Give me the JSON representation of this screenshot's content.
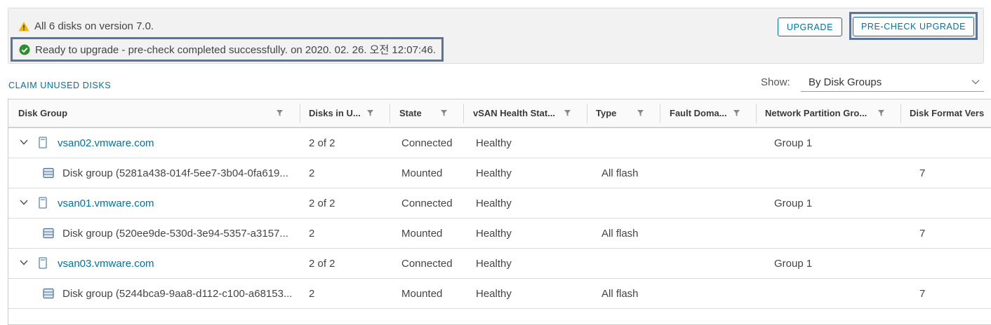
{
  "status": {
    "warning_text": "All 6 disks on version 7.0.",
    "success_text": "Ready to upgrade - pre-check completed successfully. on 2020. 02. 26. 오전 12:07:46.",
    "warning_icon": "warning-triangle-icon",
    "success_icon": "check-circle-icon",
    "warning_color": "#f2b705",
    "success_color": "#2e8d2e"
  },
  "actions": {
    "upgrade_label": "UPGRADE",
    "precheck_label": "PRE-CHECK UPGRADE",
    "claim_label": "CLAIM UNUSED DISKS"
  },
  "view": {
    "show_label": "Show:",
    "show_value": "By Disk Groups"
  },
  "table": {
    "columns": [
      "Disk Group",
      "Disks in U...",
      "State",
      "vSAN Health Stat...",
      "Type",
      "Fault Doma...",
      "Network Partition Gro...",
      "Disk Format Vers"
    ],
    "rows": [
      {
        "kind": "host",
        "disk_group": "vsan02.vmware.com",
        "disks": "2 of 2",
        "state": "Connected",
        "health": "Healthy",
        "type": "",
        "fault": "",
        "partition": "Group 1",
        "format": ""
      },
      {
        "kind": "diskgroup",
        "disk_group": "Disk group (5281a438-014f-5ee7-3b04-0fa619...",
        "disks": "2",
        "state": "Mounted",
        "health": "Healthy",
        "type": "All flash",
        "fault": "",
        "partition": "",
        "format": "7"
      },
      {
        "kind": "host",
        "disk_group": "vsan01.vmware.com",
        "disks": "2 of 2",
        "state": "Connected",
        "health": "Healthy",
        "type": "",
        "fault": "",
        "partition": "Group 1",
        "format": ""
      },
      {
        "kind": "diskgroup",
        "disk_group": "Disk group (520ee9de-530d-3e94-5357-a3157...",
        "disks": "2",
        "state": "Mounted",
        "health": "Healthy",
        "type": "All flash",
        "fault": "",
        "partition": "",
        "format": "7"
      },
      {
        "kind": "host",
        "disk_group": "vsan03.vmware.com",
        "disks": "2 of 2",
        "state": "Connected",
        "health": "Healthy",
        "type": "",
        "fault": "",
        "partition": "Group 1",
        "format": ""
      },
      {
        "kind": "diskgroup",
        "disk_group": "Disk group (5244bca9-9aa8-d112-c100-a68153...",
        "disks": "2",
        "state": "Mounted",
        "health": "Healthy",
        "type": "All flash",
        "fault": "",
        "partition": "",
        "format": "7"
      }
    ]
  },
  "colors": {
    "accent": "#0072a3",
    "highlight_border": "#5b7599"
  }
}
